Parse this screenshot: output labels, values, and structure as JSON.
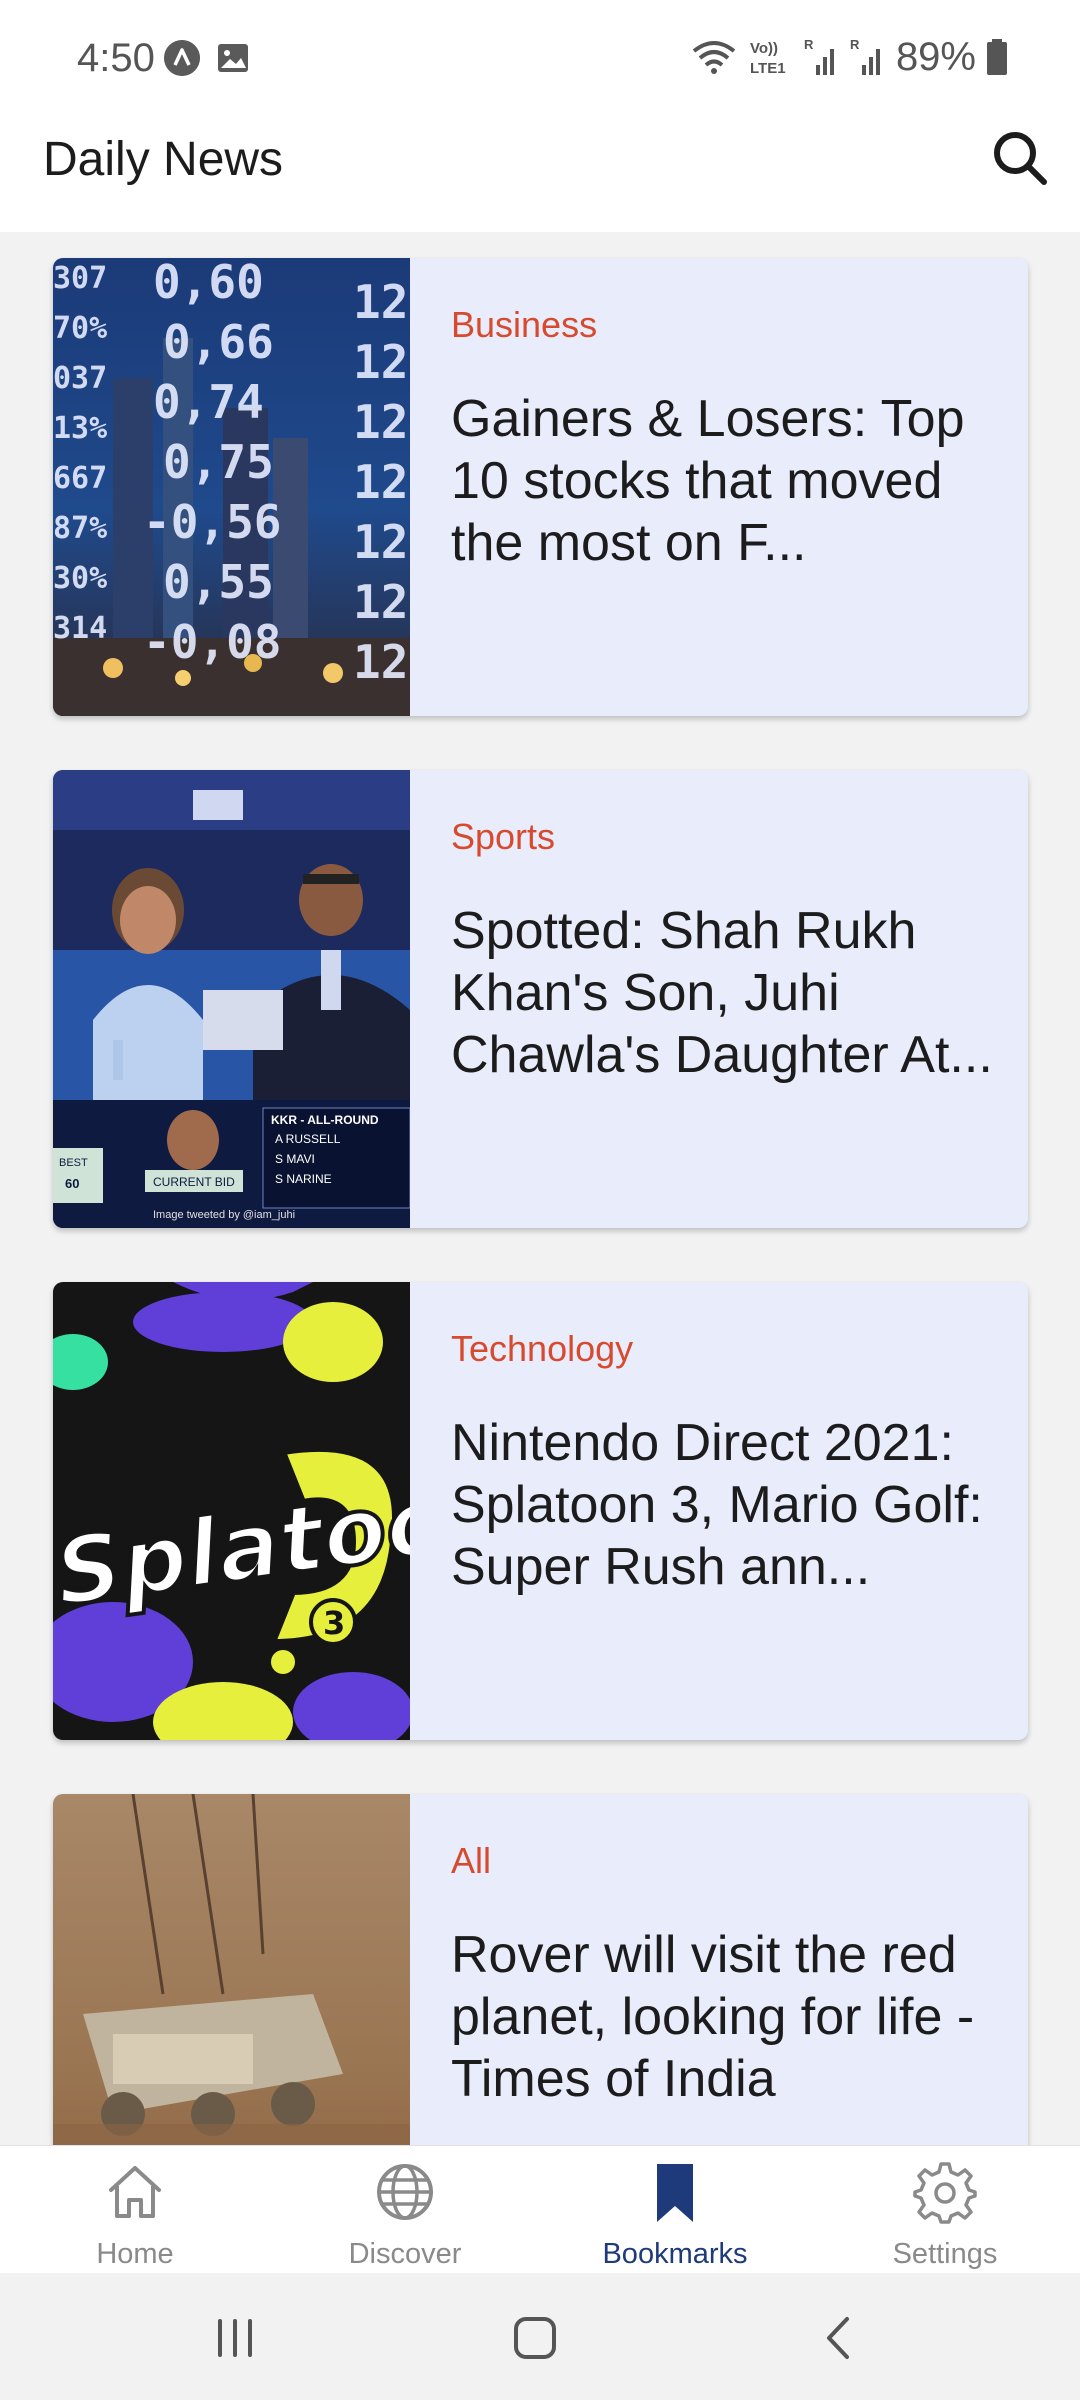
{
  "status_bar": {
    "time": "4:50",
    "battery": "89%",
    "icons": [
      "alert-icon",
      "image-icon",
      "wifi-icon",
      "volte-icon",
      "signal-icon",
      "signal-icon",
      "battery-icon"
    ]
  },
  "header": {
    "title": "Daily News",
    "search_icon": "search-icon"
  },
  "colors": {
    "card_bg": "#e8ecfb",
    "category": "#d84a2e",
    "nav_active": "#1e3a7b",
    "nav_inactive": "#8a8a8a",
    "content_bg": "#f2f2f2"
  },
  "articles": [
    {
      "category": "Business",
      "title": "Gainers & Losers: Top 10 stocks that moved the most on F...",
      "image": "stock-ticker-image"
    },
    {
      "category": "Sports",
      "title": "Spotted: Shah Rukh Khan's Son, Juhi Chawla's Daughter At...",
      "image": "ipl-auction-image",
      "image_caption": "Image tweeted by @iam_juhi",
      "image_overlay": {
        "team": "KKR - ALL-ROUND",
        "players": [
          "A RUSSELL",
          "S MAVI",
          "S NARINE"
        ],
        "bid_label": "CURRENT BID",
        "best_label": "BEST",
        "best_value": "60"
      }
    },
    {
      "category": "Technology",
      "title": "Nintendo Direct 2021: Splatoon 3, Mario Golf: Super Rush ann...",
      "image": "splatoon-logo-image",
      "image_text": "Splatoon",
      "image_number": "3"
    },
    {
      "category": "All",
      "title": "Rover will visit the red planet, looking for life - Times of India",
      "image": "mars-rover-image"
    }
  ],
  "bottom_nav": {
    "items": [
      {
        "label": "Home",
        "icon": "home-icon",
        "active": false
      },
      {
        "label": "Discover",
        "icon": "globe-icon",
        "active": false
      },
      {
        "label": "Bookmarks",
        "icon": "bookmark-icon",
        "active": true
      },
      {
        "label": "Settings",
        "icon": "gear-icon",
        "active": false
      }
    ]
  },
  "system_nav": {
    "buttons": [
      "recent-apps-icon",
      "home-button-icon",
      "back-icon"
    ]
  }
}
